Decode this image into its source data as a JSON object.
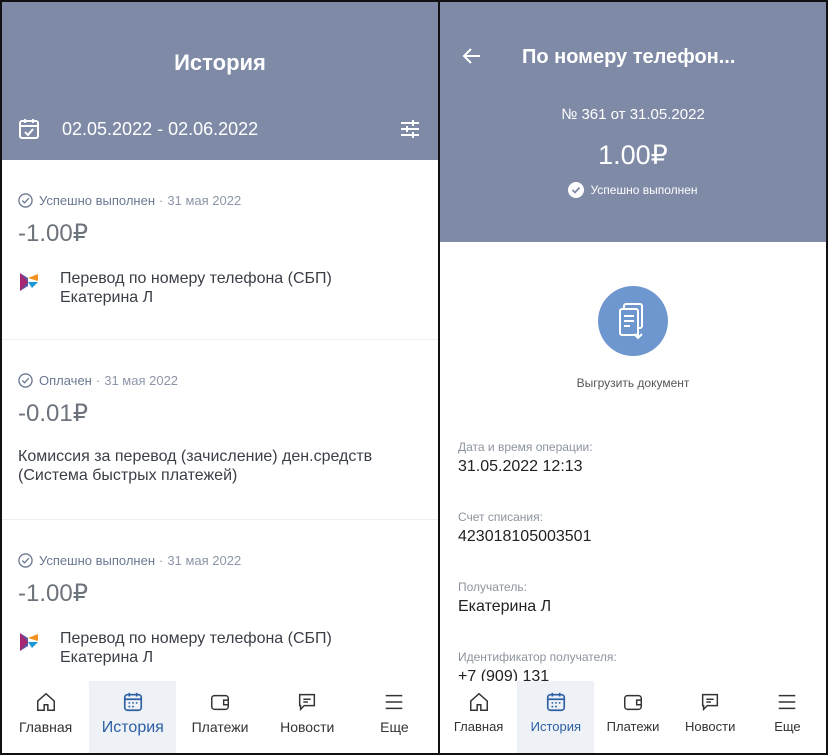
{
  "left": {
    "title": "История",
    "date_range": "02.05.2022 - 02.06.2022",
    "transactions": [
      {
        "status": "Успешно выполнен",
        "separator": "·",
        "date": "31 мая 2022",
        "amount": "-1.00₽",
        "line1": "Перевод по номеру телефона (СБП)",
        "line2": "Екатерина Л",
        "has_logo": true
      },
      {
        "status": "Оплачен",
        "separator": "·",
        "date": "31 мая 2022",
        "amount": "-0.01₽",
        "line1": "Комиссия за перевод (зачисление) ден.средств",
        "line2": "(Система быстрых платежей)",
        "has_logo": false
      },
      {
        "status": "Успешно выполнен",
        "separator": "·",
        "date": "31 мая 2022",
        "amount": "-1.00₽",
        "line1": "Перевод по номеру телефона (СБП)",
        "line2": "Екатерина Л",
        "has_logo": true
      }
    ],
    "nav": [
      {
        "label": "Главная",
        "icon": "home-icon",
        "active": false
      },
      {
        "label": "История",
        "icon": "calendar-icon",
        "active": true
      },
      {
        "label": "Платежи",
        "icon": "wallet-icon",
        "active": false
      },
      {
        "label": "Новости",
        "icon": "chat-icon",
        "active": false
      },
      {
        "label": "Еще",
        "icon": "menu-icon",
        "active": false
      }
    ]
  },
  "right": {
    "title": "По номеру телефон...",
    "number": "№ 361 от 31.05.2022",
    "amount": "1.00₽",
    "status": "Успешно выполнен",
    "download_label": "Выгрузить документ",
    "fields": [
      {
        "label": "Дата и время операции:",
        "value": "31.05.2022 12:13"
      },
      {
        "label": "Счет списания:",
        "value": "423018105003501"
      },
      {
        "label": "Получатель:",
        "value": "Екатерина Л"
      },
      {
        "label": "Идентификатор получателя:",
        "value": "+7 (909) 131"
      }
    ],
    "nav": [
      {
        "label": "Главная",
        "icon": "home-icon",
        "active": false
      },
      {
        "label": "История",
        "icon": "calendar-icon",
        "active": true
      },
      {
        "label": "Платежи",
        "icon": "wallet-icon",
        "active": false
      },
      {
        "label": "Новости",
        "icon": "chat-icon",
        "active": false
      },
      {
        "label": "Еще",
        "icon": "menu-icon",
        "active": false
      }
    ]
  },
  "colors": {
    "header": "#7e8aa6",
    "accent": "#2c5fa3",
    "status": "#6a7891",
    "doc_circle": "#6e96cf"
  }
}
